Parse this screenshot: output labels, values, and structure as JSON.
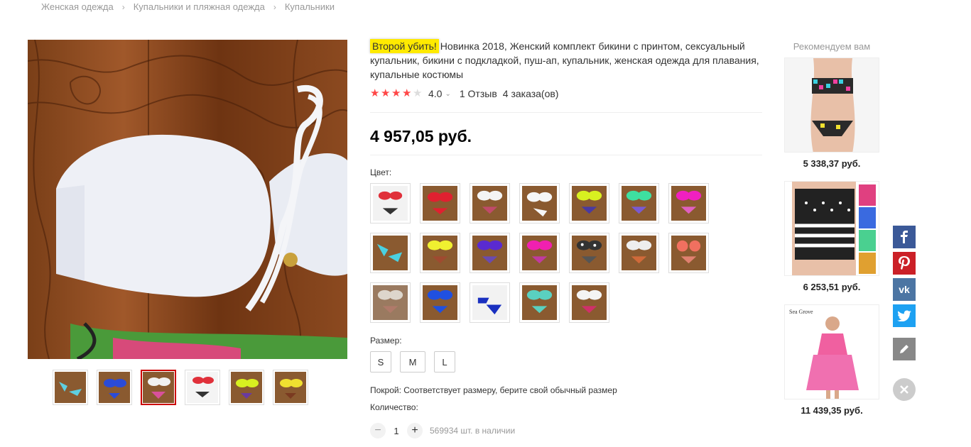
{
  "breadcrumb": [
    "Женская одежда",
    "Купальники и пляжная одежда",
    "Купальники"
  ],
  "product": {
    "tag": "Второй убить!",
    "title": "Новинка 2018, Женский комплект бикини с принтом, сексуальный купальник, бикини с подкладкой, пуш-ап, купальник, женская одежда для плавания, купальные костюмы",
    "rating": "4.0",
    "rating_stars": 4,
    "reviews": "1 Отзыв",
    "orders": "4 заказа(ов)",
    "price": "4 957,05 руб.",
    "color_label": "Цвет:",
    "size_label": "Размер:",
    "sizes": [
      "S",
      "M",
      "L"
    ],
    "fit": "Покрой: Соответствует размеру, берите свой обычный размер",
    "quantity_label": "Количество:",
    "quantity": "1",
    "stock": "569934 шт. в наличии"
  },
  "colors": {
    "accent": "#ff4747",
    "tag_bg": "#ffea00",
    "facebook": "#3b5998",
    "pinterest": "#cb2027",
    "vk": "#4c75a3",
    "twitter": "#1da1f2",
    "edit": "#888888"
  },
  "recommend": {
    "title": "Рекомендуем вам",
    "items": [
      {
        "price": "5 338,37 руб."
      },
      {
        "price": "6 253,51 руб."
      },
      {
        "price": "11 439,35 руб.",
        "brand": "Sea Grove"
      }
    ]
  },
  "share": [
    "facebook-icon",
    "pinterest-icon",
    "vk-icon",
    "twitter-icon",
    "edit-icon"
  ]
}
